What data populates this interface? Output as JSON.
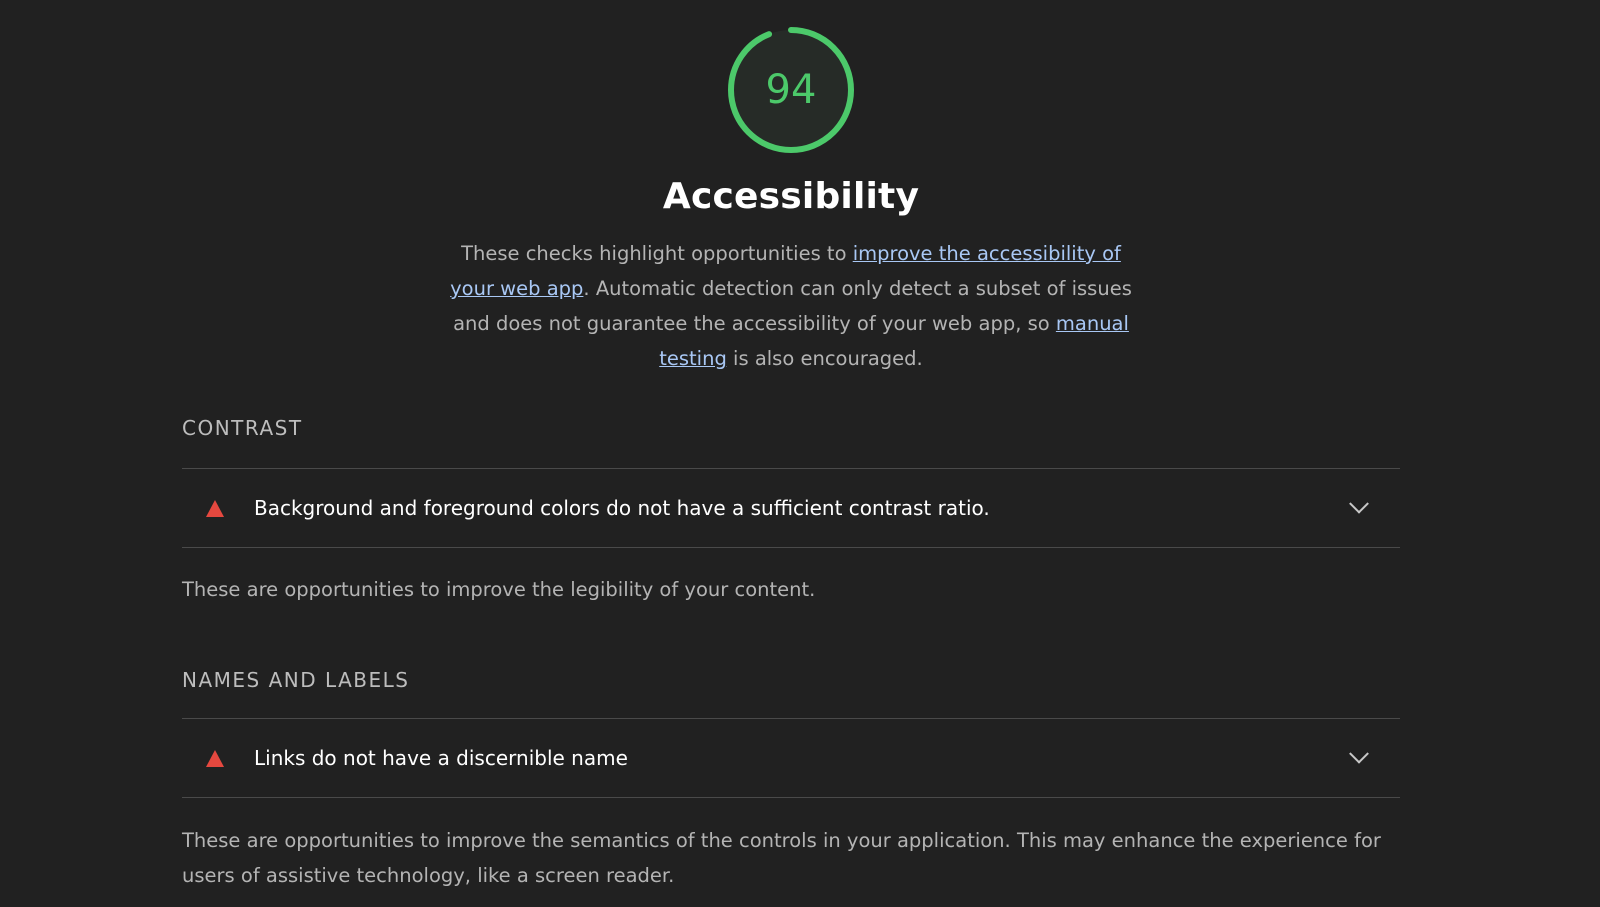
{
  "score": {
    "value": 94,
    "fraction": 0.94,
    "color": "#4cc96a"
  },
  "category": {
    "title": "Accessibility",
    "description": {
      "text1": "These checks highlight opportunities to ",
      "link1": "improve the accessibility of your web app",
      "text2": ". Automatic detection can only detect a subset of issues and does not guarantee the accessibility of your web app, so ",
      "link2": "manual testing",
      "text3": " is also encouraged."
    }
  },
  "groups": [
    {
      "title": "CONTRAST",
      "audit": "Background and foreground colors do not have a sufficient contrast ratio.",
      "description": "These are opportunities to improve the legibility of your content."
    },
    {
      "title": "NAMES AND LABELS",
      "audit": "Links do not have a discernible name",
      "description": "These are opportunities to improve the semantics of the controls in your application. This may enhance the experience for users of assistive technology, like a screen reader."
    }
  ],
  "colors": {
    "fail": "#e5483f",
    "link": "#a9c8f5",
    "background": "#212121"
  },
  "icons": {
    "fail": "warning-triangle-icon",
    "expand": "chevron-down-icon"
  }
}
